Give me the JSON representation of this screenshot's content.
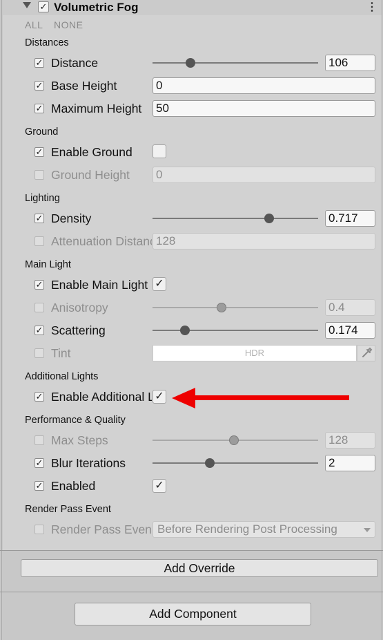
{
  "component": {
    "title": "Volumetric Fog",
    "enabled_glyph": "✓",
    "menu_glyph": "⋮",
    "links": {
      "all": "ALL",
      "none": "NONE"
    }
  },
  "check_glyph": "✓",
  "sections": {
    "distances": "Distances",
    "ground": "Ground",
    "lighting": "Lighting",
    "main_light": "Main Light",
    "additional_lights": "Additional Lights",
    "performance": "Performance & Quality",
    "render_pass": "Render Pass Event"
  },
  "rows": {
    "distance": {
      "label": "Distance",
      "value": "106",
      "slider_fraction": 0.23
    },
    "base_height": {
      "label": "Base Height",
      "value": "0"
    },
    "maximum_height": {
      "label": "Maximum Height",
      "value": "50"
    },
    "enable_ground": {
      "label": "Enable Ground"
    },
    "ground_height": {
      "label": "Ground Height",
      "value": "0"
    },
    "density": {
      "label": "Density",
      "value": "0.717",
      "slider_fraction": 0.705
    },
    "attenuation": {
      "label": "Attenuation Distance",
      "value": "128"
    },
    "enable_main_light": {
      "label": "Enable Main Light"
    },
    "anisotropy": {
      "label": "Anisotropy",
      "value": "0.4",
      "slider_fraction": 0.415
    },
    "scattering": {
      "label": "Scattering",
      "value": "0.174",
      "slider_fraction": 0.195
    },
    "tint": {
      "label": "Tint",
      "hdr_label": "HDR",
      "color": "#ffffff"
    },
    "enable_additional": {
      "label": "Enable Additional Lights"
    },
    "max_steps": {
      "label": "Max Steps",
      "value": "128",
      "slider_fraction": 0.49
    },
    "blur_iterations": {
      "label": "Blur Iterations",
      "value": "2",
      "slider_fraction": 0.345
    },
    "enabled": {
      "label": "Enabled"
    },
    "render_pass_event": {
      "label": "Render Pass Event",
      "value": "Before Rendering Post Processing"
    }
  },
  "buttons": {
    "add_override": "Add Override",
    "add_component": "Add Component"
  },
  "annotation": {
    "color": "#ee0000",
    "shape": "arrow-left"
  }
}
